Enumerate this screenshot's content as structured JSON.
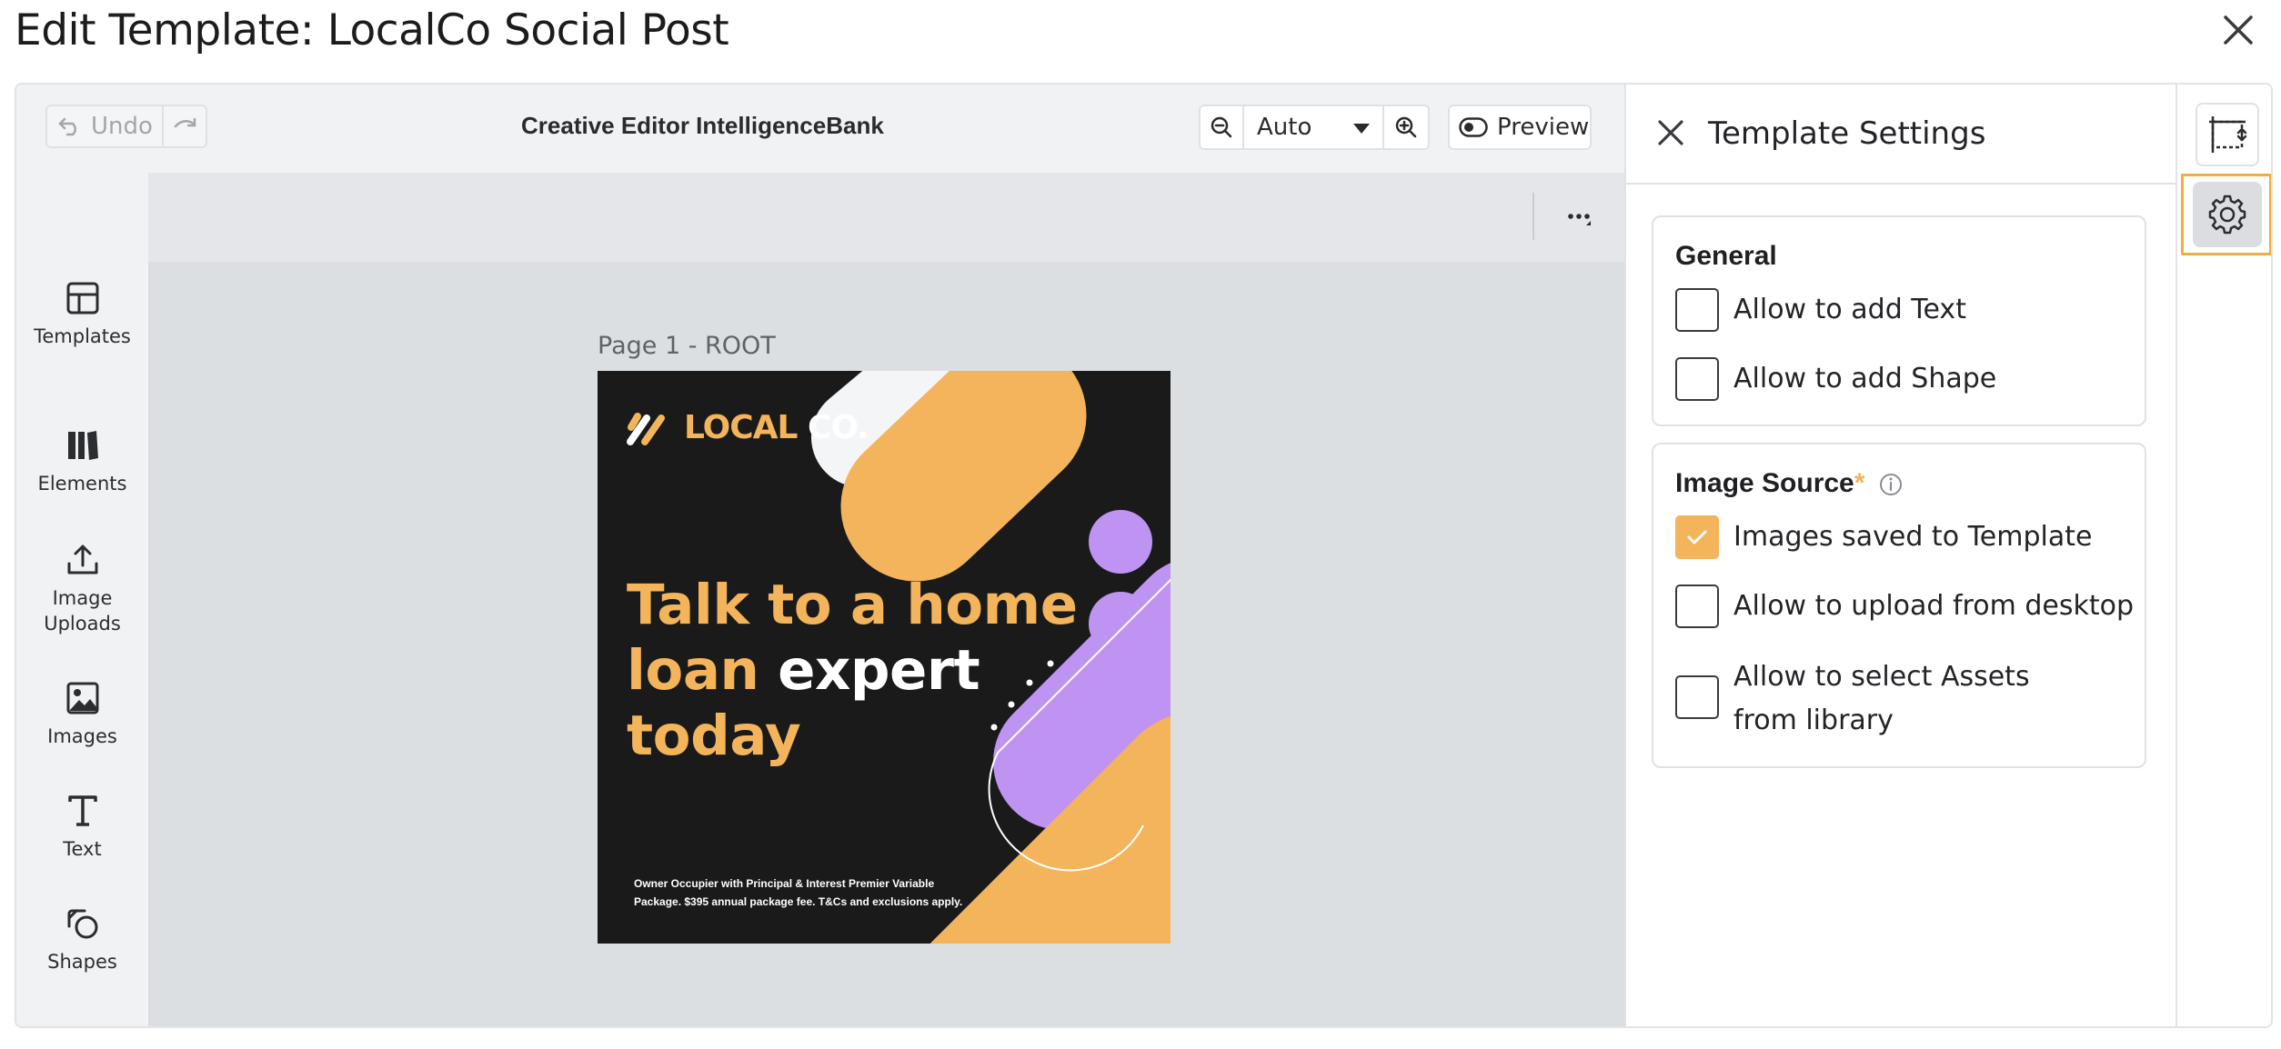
{
  "dialog": {
    "title": "Edit Template: LocalCo Social Post"
  },
  "editor": {
    "undo_label": "Undo",
    "title": "Creative Editor IntelligenceBank",
    "zoom_value": "Auto",
    "preview_label": "Preview"
  },
  "nav": {
    "items": [
      {
        "label": "Templates",
        "icon": "templates-icon"
      },
      {
        "label": "Elements",
        "icon": "elements-icon"
      },
      {
        "label": "Image Uploads",
        "icon": "upload-icon"
      },
      {
        "label": "Images",
        "icon": "image-icon"
      },
      {
        "label": "Text",
        "icon": "text-icon"
      },
      {
        "label": "Shapes",
        "icon": "shapes-icon"
      }
    ]
  },
  "canvas": {
    "page_label": "Page 1 - ROOT",
    "logo_local": "LOCAL",
    "logo_co": "CO.",
    "headline_1": "Talk to a home",
    "headline_2a": "loan",
    "headline_2b": " expert",
    "headline_3": "today",
    "disclaimer_1": "Owner Occupier with Principal & Interest Premier Variable",
    "disclaimer_2": "Package. $395 annual package fee. T&Cs and exclusions apply.",
    "colors": {
      "background": "#1a1a1a",
      "accent": "#f3b45b",
      "purple": "#bf93f2",
      "white": "#f3f5f7"
    }
  },
  "settings": {
    "title": "Template Settings",
    "general": {
      "title": "General",
      "options": [
        {
          "label": "Allow to add Text",
          "checked": false
        },
        {
          "label": "Allow to add Shape",
          "checked": false
        }
      ]
    },
    "image_source": {
      "title": "Image Source",
      "required_mark": "*",
      "options": [
        {
          "label": "Images saved to Template",
          "checked": true
        },
        {
          "label": "Allow to upload from desktop",
          "checked": false
        },
        {
          "label": "Allow to select Assets from library",
          "checked": false
        }
      ]
    }
  },
  "rail": {
    "items": [
      {
        "icon": "resize-icon",
        "active": false
      },
      {
        "icon": "gear-icon",
        "active": true
      }
    ]
  },
  "theme": {
    "accent": "#f3b45b",
    "highlight_border": "#f2ad3a"
  }
}
